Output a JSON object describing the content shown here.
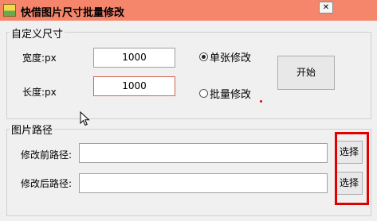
{
  "window": {
    "title": "快借图片尺寸批量修改",
    "close_glyph": "✕",
    "title_bar_color": "#f6866b"
  },
  "custom_size": {
    "group_title": "自定义尺寸",
    "width_label": "宽度:px",
    "width_value": "1000",
    "length_label": "长度:px",
    "length_value": "1000",
    "radio_single": {
      "label": "单张修改",
      "checked": true
    },
    "radio_batch": {
      "label": "批量修改",
      "checked": false
    },
    "start_label": "开始"
  },
  "image_path": {
    "group_title": "图片路径",
    "before_label": "修改前路径:",
    "before_value": "",
    "after_label": "修改后路径:",
    "after_value": "",
    "choose_label_1": "选择",
    "choose_label_2": "选择"
  },
  "highlight_color": "#e00000"
}
